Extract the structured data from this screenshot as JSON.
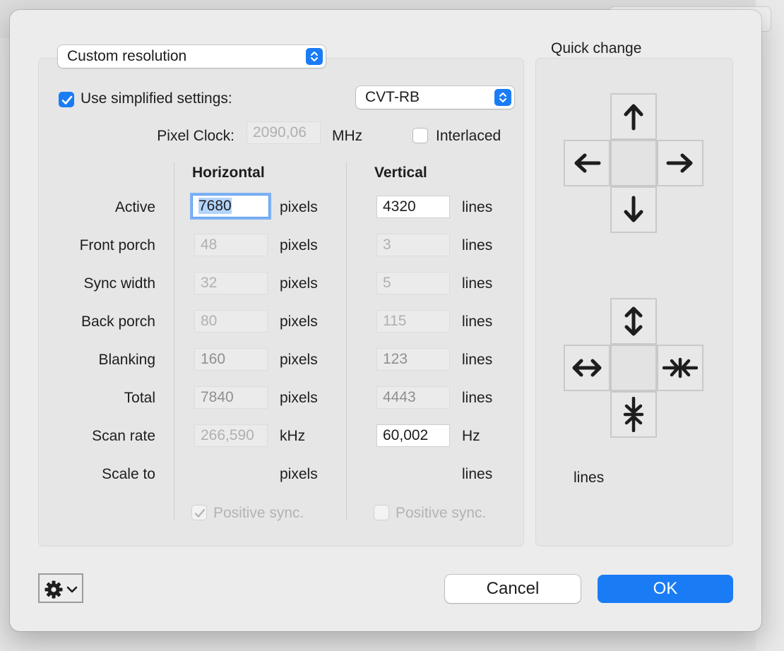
{
  "mode_popup": {
    "value": "Custom resolution"
  },
  "simplified": {
    "checked": true,
    "label": "Use simplified settings:"
  },
  "timing_popup": {
    "value": "CVT-RB"
  },
  "pixel_clock": {
    "label": "Pixel Clock:",
    "value": "2090,06",
    "unit": "MHz"
  },
  "interlaced": {
    "checked": false,
    "label": "Interlaced"
  },
  "columns": {
    "horizontal": "Horizontal",
    "vertical": "Vertical"
  },
  "rows": [
    {
      "label": "Active",
      "h": "7680",
      "h_unit": "pixels",
      "v": "4320",
      "v_unit": "lines"
    },
    {
      "label": "Front porch",
      "h": "48",
      "h_unit": "pixels",
      "v": "3",
      "v_unit": "lines"
    },
    {
      "label": "Sync width",
      "h": "32",
      "h_unit": "pixels",
      "v": "5",
      "v_unit": "lines"
    },
    {
      "label": "Back porch",
      "h": "80",
      "h_unit": "pixels",
      "v": "115",
      "v_unit": "lines"
    },
    {
      "label": "Blanking",
      "h": "160",
      "h_unit": "pixels",
      "v": "123",
      "v_unit": "lines"
    },
    {
      "label": "Total",
      "h": "7840",
      "h_unit": "pixels",
      "v": "4443",
      "v_unit": "lines"
    },
    {
      "label": "Scan rate",
      "h": "266,590",
      "h_unit": "kHz",
      "v": "60,002",
      "v_unit": "Hz"
    },
    {
      "label": "Scale to",
      "h": "",
      "h_unit": "pixels",
      "v": "",
      "v_unit": "lines"
    }
  ],
  "positive_sync": {
    "h_label": "Positive sync.",
    "h_checked": true,
    "v_label": "Positive sync.",
    "v_checked": false
  },
  "quick_change": {
    "title": "Quick change",
    "unit": "lines"
  },
  "buttons": {
    "cancel": "Cancel",
    "ok": "OK"
  },
  "icons": {
    "move": [
      "arrow-up-icon",
      "arrow-left-icon",
      "arrow-right-icon",
      "arrow-down-icon"
    ],
    "resize": [
      "expand-vertical-icon",
      "expand-horizontal-icon",
      "shrink-horizontal-icon",
      "shrink-vertical-icon"
    ],
    "settings": "gear-icon"
  },
  "colors": {
    "accent": "#1a7cf5",
    "focus_ring": "#7eb2f3"
  }
}
